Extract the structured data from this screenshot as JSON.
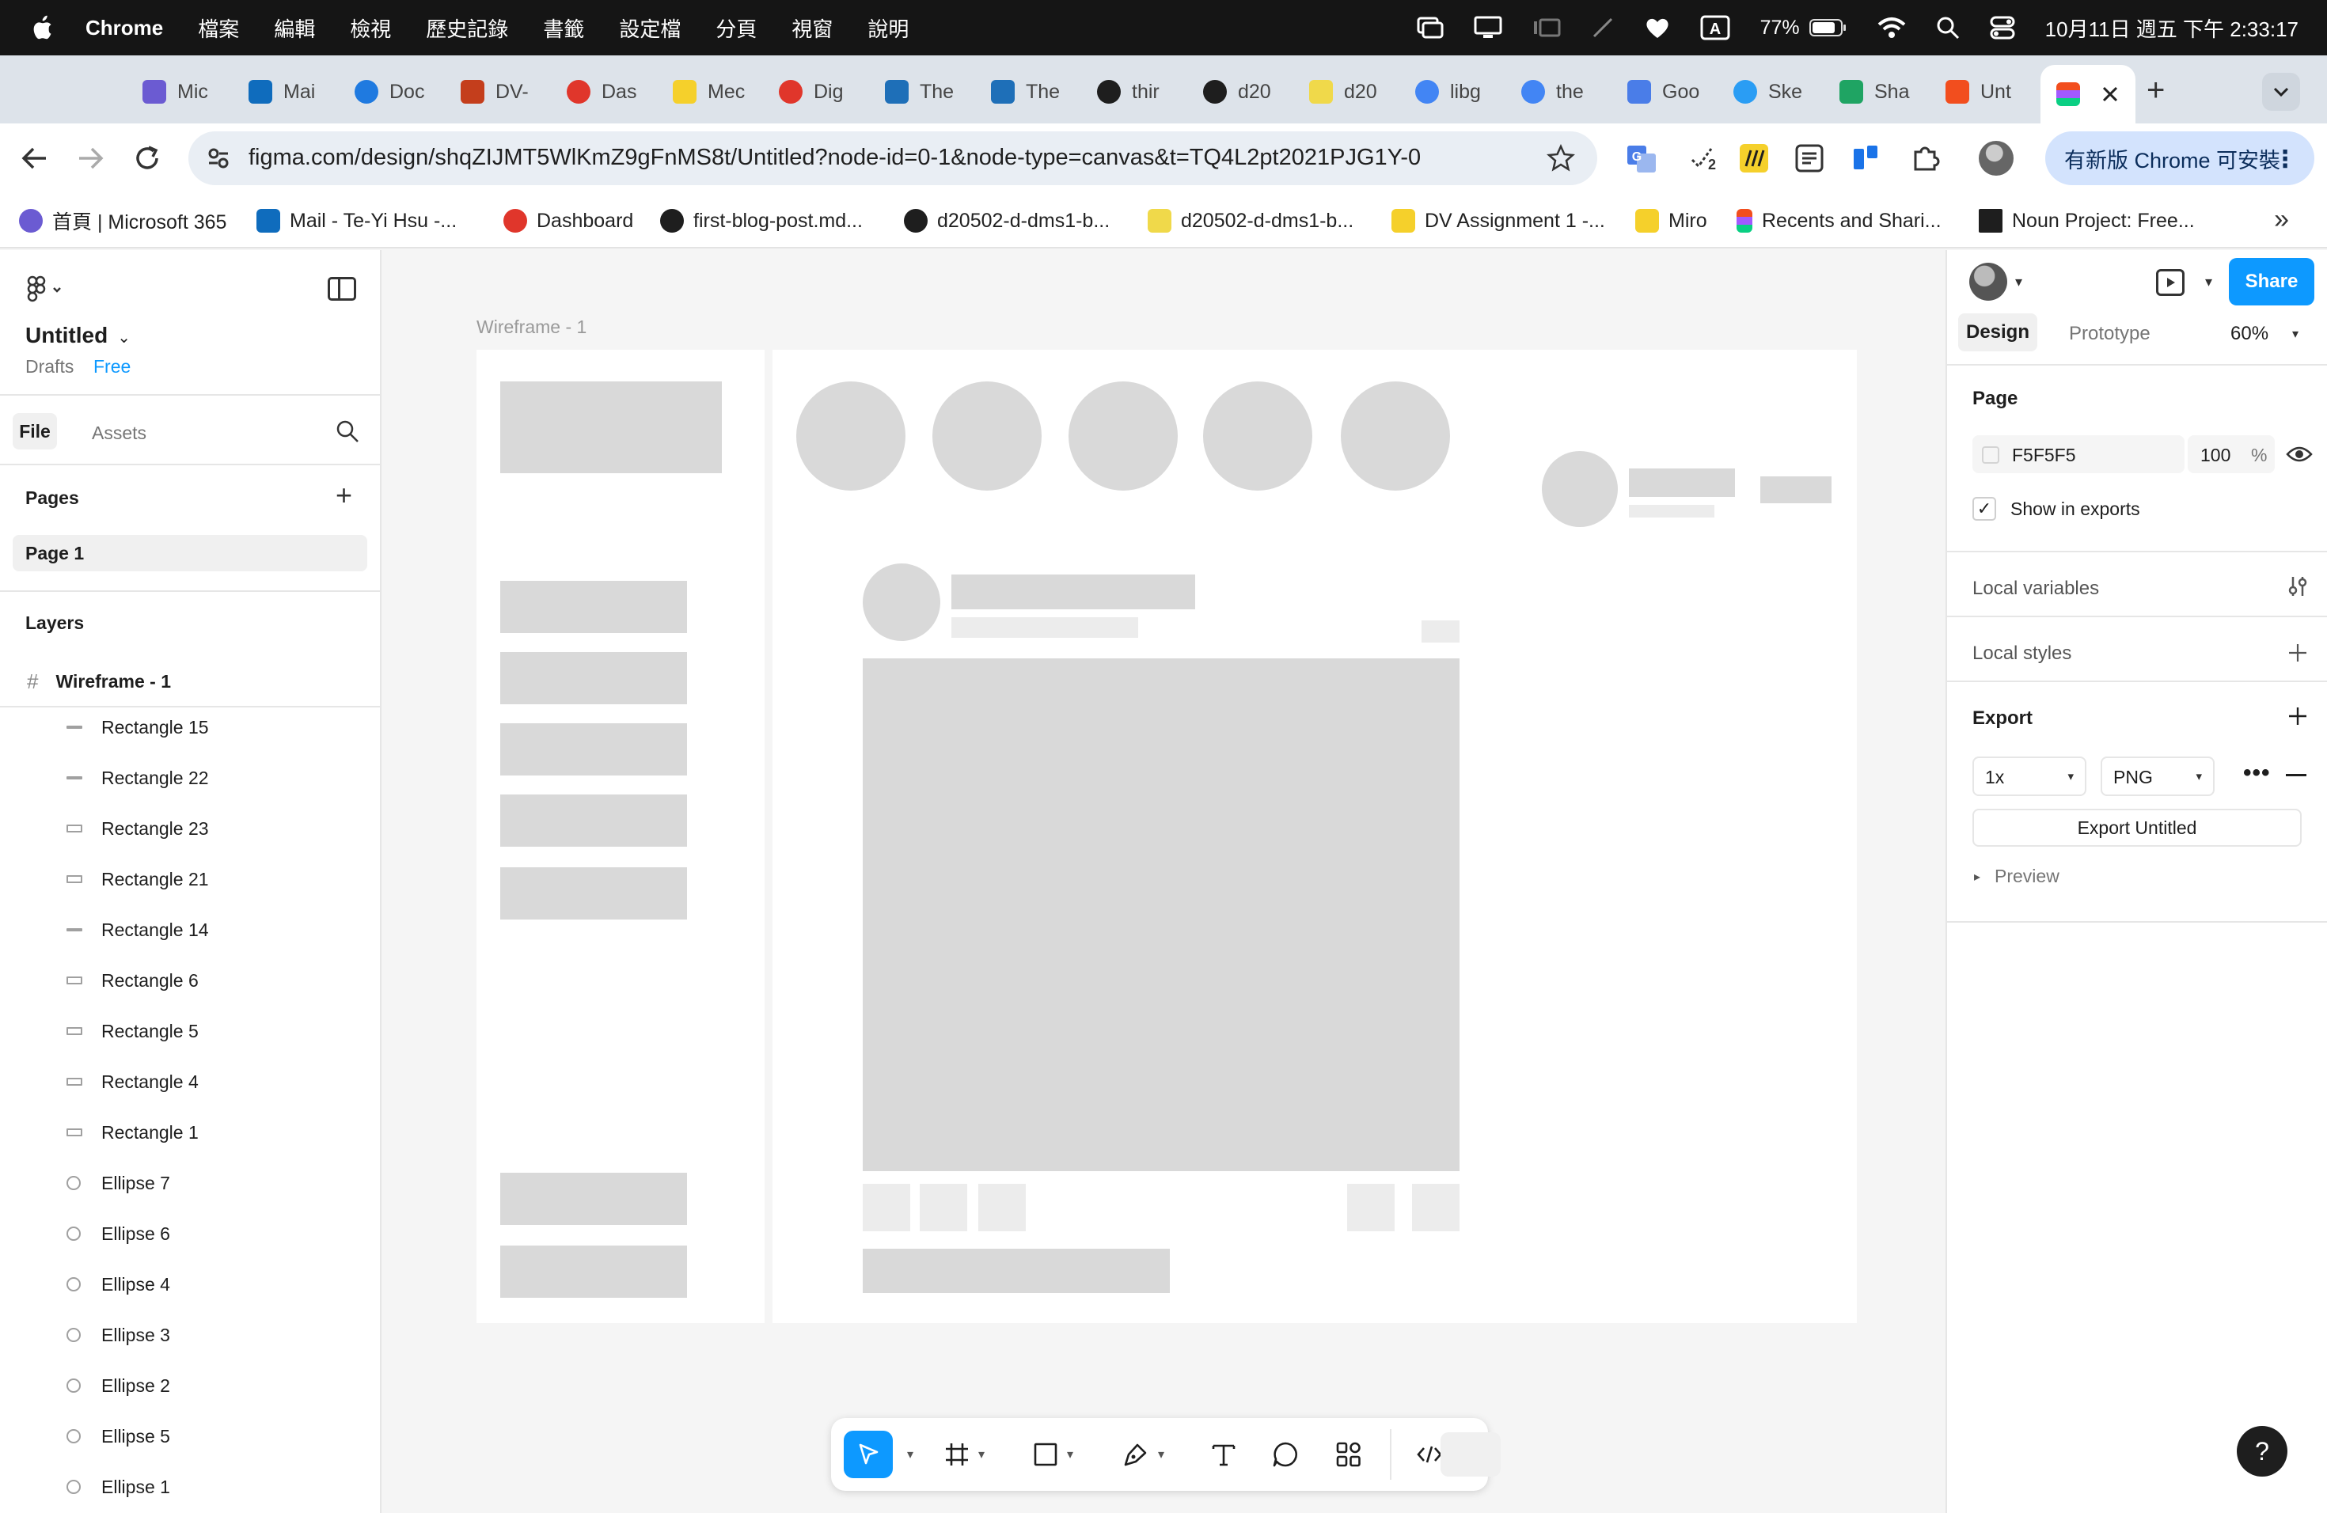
{
  "menubar": {
    "app": "Chrome",
    "items": [
      "檔案",
      "編輯",
      "檢視",
      "歷史記錄",
      "書籤",
      "設定檔",
      "分頁",
      "視窗",
      "說明"
    ],
    "battery": "77%",
    "input_indicator": "A",
    "datetime": "10月11日 週五 下午 2:33:17"
  },
  "tabs": [
    {
      "label": "Mic",
      "color": "#6b5bd2"
    },
    {
      "label": "Mai",
      "color": "#0f6cbd"
    },
    {
      "label": "Doc",
      "color": "#1f7ae0"
    },
    {
      "label": "DV-",
      "color": "#c43e1c"
    },
    {
      "label": "Das",
      "color": "#e0362b"
    },
    {
      "label": "Mec",
      "color": "#f5d02b"
    },
    {
      "label": "Dig",
      "color": "#e0362b"
    },
    {
      "label": "The",
      "color": "#1e6fb8"
    },
    {
      "label": "The",
      "color": "#1e6fb8"
    },
    {
      "label": "thir",
      "color": "#1e1e1e"
    },
    {
      "label": "d20",
      "color": "#1e1e1e"
    },
    {
      "label": "d20",
      "color": "#f0d94a"
    },
    {
      "label": "libg",
      "color": "#4285f4"
    },
    {
      "label": "the",
      "color": "#4285f4"
    },
    {
      "label": "Goo",
      "color": "#4a7de8"
    },
    {
      "label": "Ske",
      "color": "#2a9df4"
    },
    {
      "label": "Sha",
      "color": "#1fa463"
    },
    {
      "label": "Unt",
      "color": "#f24e1e"
    }
  ],
  "address": {
    "url": "figma.com/design/shqZIJMT5WlKmZ9gFnMS8t/Untitled?node-id=0-1&node-type=canvas&t=TQ4L2pt2021PJG1Y-0",
    "update_label": "有新版 Chrome 可安裝",
    "ext_badge": "2"
  },
  "bookmarks": [
    {
      "label": "首頁 | Microsoft 365",
      "color": "#6b5bd2"
    },
    {
      "label": "Mail - Te-Yi Hsu -...",
      "color": "#0f6cbd"
    },
    {
      "label": "Dashboard",
      "color": "#e0362b"
    },
    {
      "label": "first-blog-post.md...",
      "color": "#1e1e1e"
    },
    {
      "label": "d20502-d-dms1-b...",
      "color": "#1e1e1e"
    },
    {
      "label": "d20502-d-dms1-b...",
      "color": "#f0d94a"
    },
    {
      "label": "DV Assignment 1 -...",
      "color": "#f5d02b"
    },
    {
      "label": "Miro",
      "color": "#f5d02b"
    },
    {
      "label": "Recents and Shari...",
      "color": "#f24e1e"
    },
    {
      "label": "Noun Project: Free...",
      "color": "#1e1e1e"
    }
  ],
  "leftpanel": {
    "file_name": "Untitled",
    "location": "Drafts",
    "plan": "Free",
    "tab_file": "File",
    "tab_assets": "Assets",
    "pages_heading": "Pages",
    "page1": "Page 1",
    "layers_heading": "Layers",
    "frame_name": "Wireframe - 1",
    "layers": [
      {
        "name": "Rectangle 15",
        "icon": "line-icon"
      },
      {
        "name": "Rectangle 22",
        "icon": "line-icon"
      },
      {
        "name": "Rectangle 23",
        "icon": "rectangle-icon"
      },
      {
        "name": "Rectangle 21",
        "icon": "rectangle-icon"
      },
      {
        "name": "Rectangle 14",
        "icon": "line-icon"
      },
      {
        "name": "Rectangle 6",
        "icon": "rectangle-icon"
      },
      {
        "name": "Rectangle 5",
        "icon": "rectangle-icon"
      },
      {
        "name": "Rectangle 4",
        "icon": "rectangle-icon"
      },
      {
        "name": "Rectangle 1",
        "icon": "rectangle-icon"
      },
      {
        "name": "Ellipse 7",
        "icon": "ellipse-icon"
      },
      {
        "name": "Ellipse 6",
        "icon": "ellipse-icon"
      },
      {
        "name": "Ellipse 4",
        "icon": "ellipse-icon"
      },
      {
        "name": "Ellipse 3",
        "icon": "ellipse-icon"
      },
      {
        "name": "Ellipse 2",
        "icon": "ellipse-icon"
      },
      {
        "name": "Ellipse 5",
        "icon": "ellipse-icon"
      },
      {
        "name": "Ellipse 1",
        "icon": "ellipse-icon"
      }
    ]
  },
  "canvas": {
    "frame_label": "Wireframe - 1"
  },
  "rightpanel": {
    "share": "Share",
    "tab_design": "Design",
    "tab_prototype": "Prototype",
    "zoom": "60%",
    "page_heading": "Page",
    "page_fill_hex": "F5F5F5",
    "page_opacity": "100",
    "page_opacity_unit": "%",
    "show_in_exports": "Show in exports",
    "local_variables": "Local variables",
    "local_styles": "Local styles",
    "export_heading": "Export",
    "export_scale": "1x",
    "export_format": "PNG",
    "export_button": "Export Untitled",
    "preview": "Preview"
  },
  "help": "?"
}
